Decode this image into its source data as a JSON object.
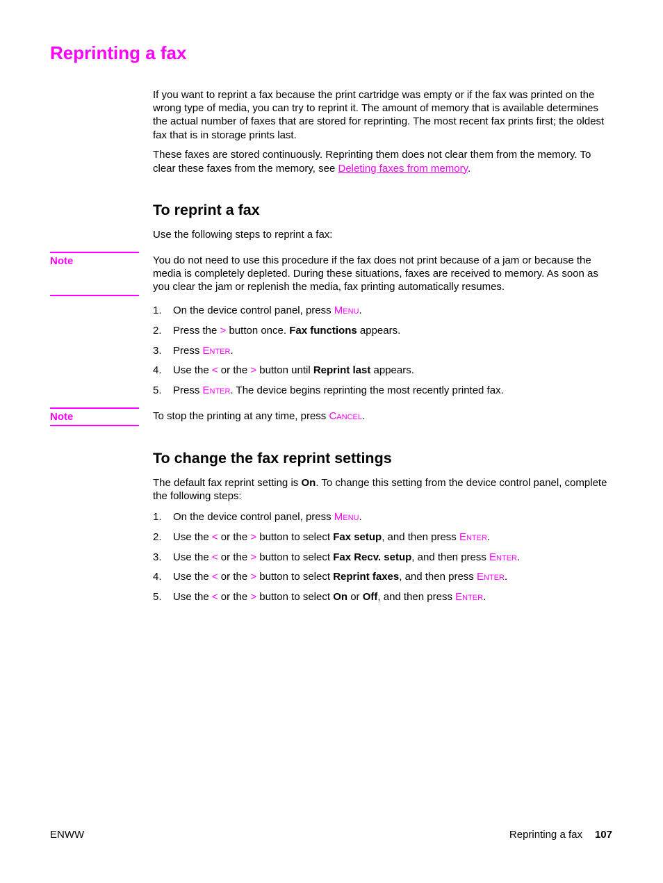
{
  "page": {
    "title": "Reprinting a fax",
    "intro": {
      "p1": "If you want to reprint a fax because the print cartridge was empty or if the fax was printed on the wrong type of media, you can try to reprint it. The amount of memory that is available determines the actual number of faxes that are stored for reprinting. The most recent fax prints first; the oldest fax that is in storage prints last.",
      "p2_before": "These faxes are stored continuously. Reprinting them does not clear them from the memory. To clear these faxes from the memory, see ",
      "p2_link": "Deleting faxes from memory",
      "p2_after": "."
    },
    "section1": {
      "heading": "To reprint a fax",
      "lead": "Use the following steps to reprint a fax:",
      "note_label": "Note",
      "note_text": "You do not need to use this procedure if the fax does not print because of a jam or because the media is completely depleted. During these situations, faxes are received to memory. As soon as you clear the jam or replenish the media, fax printing automatically resumes.",
      "steps": [
        {
          "num": "1.",
          "a": "On the device control panel, press ",
          "key": "Menu",
          "b": "."
        },
        {
          "num": "2.",
          "a": "Press the ",
          "sym": ">",
          "b": " button once. ",
          "bold": "Fax functions",
          "c": " appears."
        },
        {
          "num": "3.",
          "a": "Press ",
          "key": "Enter",
          "b": "."
        },
        {
          "num": "4.",
          "a": "Use the ",
          "sym1": "<",
          "b": " or the ",
          "sym2": ">",
          "c": " button until ",
          "bold": "Reprint last",
          "d": " appears."
        },
        {
          "num": "5.",
          "a": "Press ",
          "key": "Enter",
          "b": ". The device begins reprinting the most recently printed fax."
        }
      ],
      "note2_label": "Note",
      "note2_before": "To stop the printing at any time, press ",
      "note2_key": "Cancel",
      "note2_after": "."
    },
    "section2": {
      "heading": "To change the fax reprint settings",
      "lead_a": "The default fax reprint setting is ",
      "lead_bold": "On",
      "lead_b": ". To change this setting from the device control panel, complete the following steps:",
      "steps": [
        {
          "num": "1.",
          "a": "On the device control panel, press ",
          "key": "Menu",
          "b": "."
        },
        {
          "num": "2.",
          "a": "Use the ",
          "sym1": "<",
          "b": " or the ",
          "sym2": ">",
          "c": " button to select ",
          "bold": "Fax setup",
          "d": ", and then press ",
          "key": "Enter",
          "e": "."
        },
        {
          "num": "3.",
          "a": "Use the ",
          "sym1": "<",
          "b": " or the ",
          "sym2": ">",
          "c": " button to select ",
          "bold": "Fax Recv. setup",
          "d": ", and then press ",
          "key": "Enter",
          "e": "."
        },
        {
          "num": "4.",
          "a": "Use the ",
          "sym1": "<",
          "b": " or the ",
          "sym2": ">",
          "c": " button to select ",
          "bold": "Reprint faxes",
          "d": ", and then press ",
          "key": "Enter",
          "e": "."
        },
        {
          "num": "5.",
          "a": "Use the ",
          "sym1": "<",
          "b": " or the ",
          "sym2": ">",
          "c": " button to select ",
          "bold": "On",
          "mid": " or ",
          "bold2": "Off",
          "d": ", and then press ",
          "key": "Enter",
          "e": "."
        }
      ]
    },
    "footer": {
      "left": "ENWW",
      "section": "Reprinting a fax",
      "page_number": "107"
    },
    "colors": {
      "accent": "#ff00ff",
      "text": "#000000"
    }
  }
}
